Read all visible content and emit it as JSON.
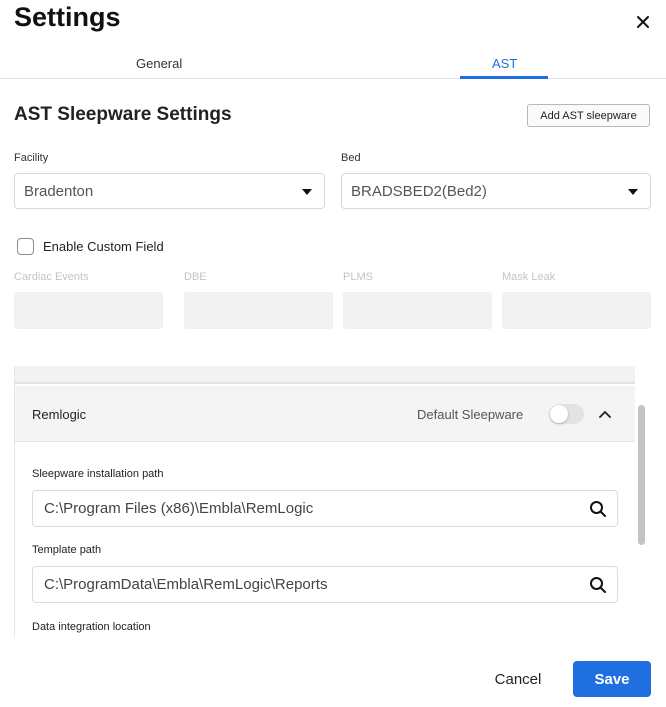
{
  "header": {
    "title": "Settings",
    "close_icon": "close-icon"
  },
  "tabs": [
    {
      "label": "General",
      "active": false
    },
    {
      "label": "AST",
      "active": true
    }
  ],
  "ast": {
    "section_title": "AST Sleepware Settings",
    "add_button": "Add AST sleepware",
    "facility": {
      "label": "Facility",
      "value": "Bradenton"
    },
    "bed": {
      "label": "Bed",
      "value": "BRADSBED2(Bed2)"
    },
    "custom_field": {
      "label": "Enable Custom Field",
      "checked": false,
      "fields": [
        {
          "label": "Cardiac Events",
          "value": ""
        },
        {
          "label": "DBE",
          "value": ""
        },
        {
          "label": "PLMS",
          "value": ""
        },
        {
          "label": "Mask Leak",
          "value": ""
        }
      ]
    }
  },
  "sleepware_panel": {
    "name": "Remlogic",
    "default_label": "Default Sleepware",
    "default_on": false,
    "installation_path": {
      "label": "Sleepware installation path",
      "value": "C:\\Program Files (x86)\\Embla\\RemLogic"
    },
    "template_path": {
      "label": "Template path",
      "value": "C:\\ProgramData\\Embla\\RemLogic\\Reports"
    },
    "data_integration": {
      "label": "Data integration location"
    }
  },
  "footer": {
    "cancel_label": "Cancel",
    "save_label": "Save"
  },
  "colors": {
    "accent": "#1f6fe0",
    "disabled_text": "#c4c4c4",
    "panel_bg": "#f4f4f4"
  }
}
